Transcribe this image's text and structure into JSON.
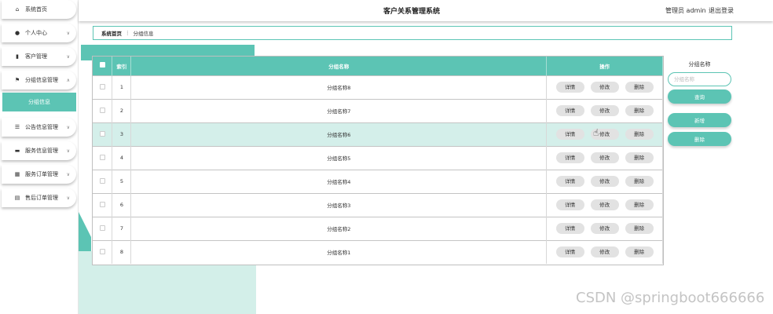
{
  "header": {
    "title": "客户关系管理系统",
    "user": "管理员 admin",
    "logout": "退出登录"
  },
  "sidebar": {
    "items": [
      {
        "label": "系统首页",
        "icon": "home-icon",
        "glyph": "⌂"
      },
      {
        "label": "个人中心",
        "icon": "person-icon",
        "glyph": "●"
      },
      {
        "label": "客户管理",
        "icon": "chart-icon",
        "glyph": "▮"
      },
      {
        "label": "分组信息管理",
        "icon": "flag-icon",
        "glyph": "⚑"
      },
      {
        "label": "公告信息管理",
        "icon": "list-icon",
        "glyph": "☰"
      },
      {
        "label": "服务信息管理",
        "icon": "box-icon",
        "glyph": "▬"
      },
      {
        "label": "服务订单管理",
        "icon": "grid-icon",
        "glyph": "▦"
      },
      {
        "label": "售后订单管理",
        "icon": "briefcase-icon",
        "glyph": "▤"
      }
    ],
    "sub_item": "分组信息"
  },
  "breadcrumb": {
    "home": "系统首页",
    "current": "分组信息"
  },
  "table": {
    "headers": [
      "索引",
      "分组名称",
      "操作"
    ],
    "rows": [
      {
        "index": "1",
        "name": "分组名称8"
      },
      {
        "index": "2",
        "name": "分组名称7"
      },
      {
        "index": "3",
        "name": "分组名称6"
      },
      {
        "index": "4",
        "name": "分组名称5"
      },
      {
        "index": "5",
        "name": "分组名称4"
      },
      {
        "index": "6",
        "name": "分组名称3"
      },
      {
        "index": "7",
        "name": "分组名称2"
      },
      {
        "index": "8",
        "name": "分组名称1"
      }
    ],
    "actions": [
      "详情",
      "修改",
      "删除"
    ]
  },
  "search": {
    "label": "分组名称",
    "placeholder": "分组名称",
    "query_button": "查询",
    "add_button": "新增",
    "delete_button": "删除"
  },
  "watermark": "CSDN @springboot666666",
  "colors": {
    "accent": "#5cc4b4",
    "highlight_row": "#d4efea"
  }
}
